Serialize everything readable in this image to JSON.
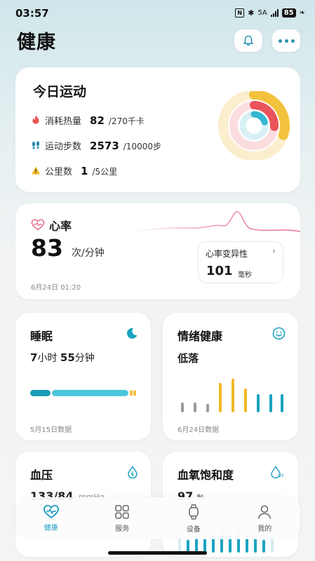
{
  "status_bar": {
    "time": "03:57",
    "network": "5A",
    "battery": "85"
  },
  "header": {
    "title": "健康"
  },
  "activity": {
    "title": "今日运动",
    "rows": [
      {
        "label": "消耗热量",
        "value": "82",
        "unit": "/270千卡",
        "icon": "flame-icon",
        "color": "#e9534f"
      },
      {
        "label": "运动步数",
        "value": "2573",
        "unit": "/10000步",
        "icon": "footprints-icon",
        "color": "#2a8fb2"
      },
      {
        "label": "公里数",
        "value": "1",
        "unit": "/5公里",
        "icon": "warning-icon",
        "color": "#f1b825"
      }
    ],
    "rings": {
      "calories": 0.3,
      "steps": 0.26,
      "distance": 0.2
    },
    "ring_colors": {
      "outer": "#f3c23d",
      "middle": "#e9535a",
      "inner": "#33b7d1"
    }
  },
  "heart_rate": {
    "title": "心率",
    "value": "83",
    "unit": "次/分钟",
    "date": "6月24日 01:20",
    "hrv": {
      "title": "心率变异性",
      "value": "101",
      "unit": "毫秒"
    }
  },
  "sleep": {
    "title": "睡眠",
    "hours": "7",
    "hours_unit": "小时",
    "minutes": "55",
    "minutes_unit": "分钟",
    "date": "5月15日数据"
  },
  "mood": {
    "title": "情绪健康",
    "status": "低落",
    "date": "6月24日数据"
  },
  "blood_pressure": {
    "title": "血压",
    "value": "133/84",
    "unit": "mmHg"
  },
  "spo2": {
    "title": "血氧饱和度",
    "value": "97",
    "unit": "%"
  },
  "nav": {
    "items": [
      {
        "label": "健康",
        "active": true
      },
      {
        "label": "服务",
        "active": false
      },
      {
        "label": "设备",
        "active": false
      },
      {
        "label": "我的",
        "active": false
      }
    ]
  },
  "accent": "#1a9cc0"
}
